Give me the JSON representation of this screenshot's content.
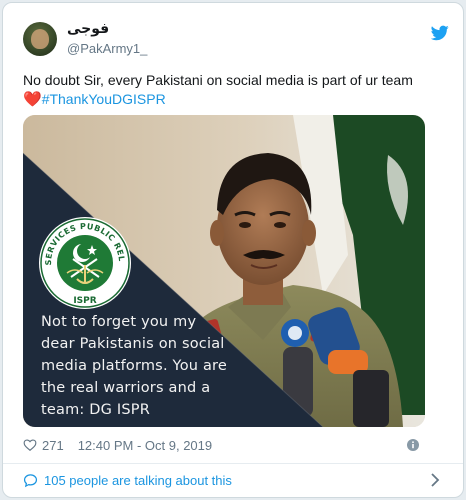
{
  "tweet": {
    "display_name": "فوجی",
    "handle": "@PakArmy1_",
    "text_line1": "No doubt Sir, every Pakistani on social media is part of ur team",
    "emoji": "❤️",
    "hashtag": "#ThankYouDGISPR"
  },
  "media": {
    "logo_arc_text": "INTER SERVICES PUBLIC RELATIONS",
    "logo_bottom_text": "ISPR",
    "overlay_lines": [
      "Not to forget you my",
      "dear Pakistanis on social",
      "media platforms. You are",
      "the real warriors and a",
      "team: DG ISPR"
    ]
  },
  "footer": {
    "likes": "271",
    "timestamp": "12:40 PM - Oct 9, 2019",
    "talking": "105 people are talking about this"
  },
  "icons": {
    "like": "heart-outline-icon",
    "info": "info-icon",
    "talking": "speech-bubble-icon",
    "chevron": "chevron-right-icon",
    "brand": "twitter-bird-icon"
  },
  "colors": {
    "twitter_blue": "#1da1f2",
    "link_blue": "#1b95e0",
    "muted": "#657786",
    "heart_red": "#e0245e",
    "text": "#14171a"
  }
}
